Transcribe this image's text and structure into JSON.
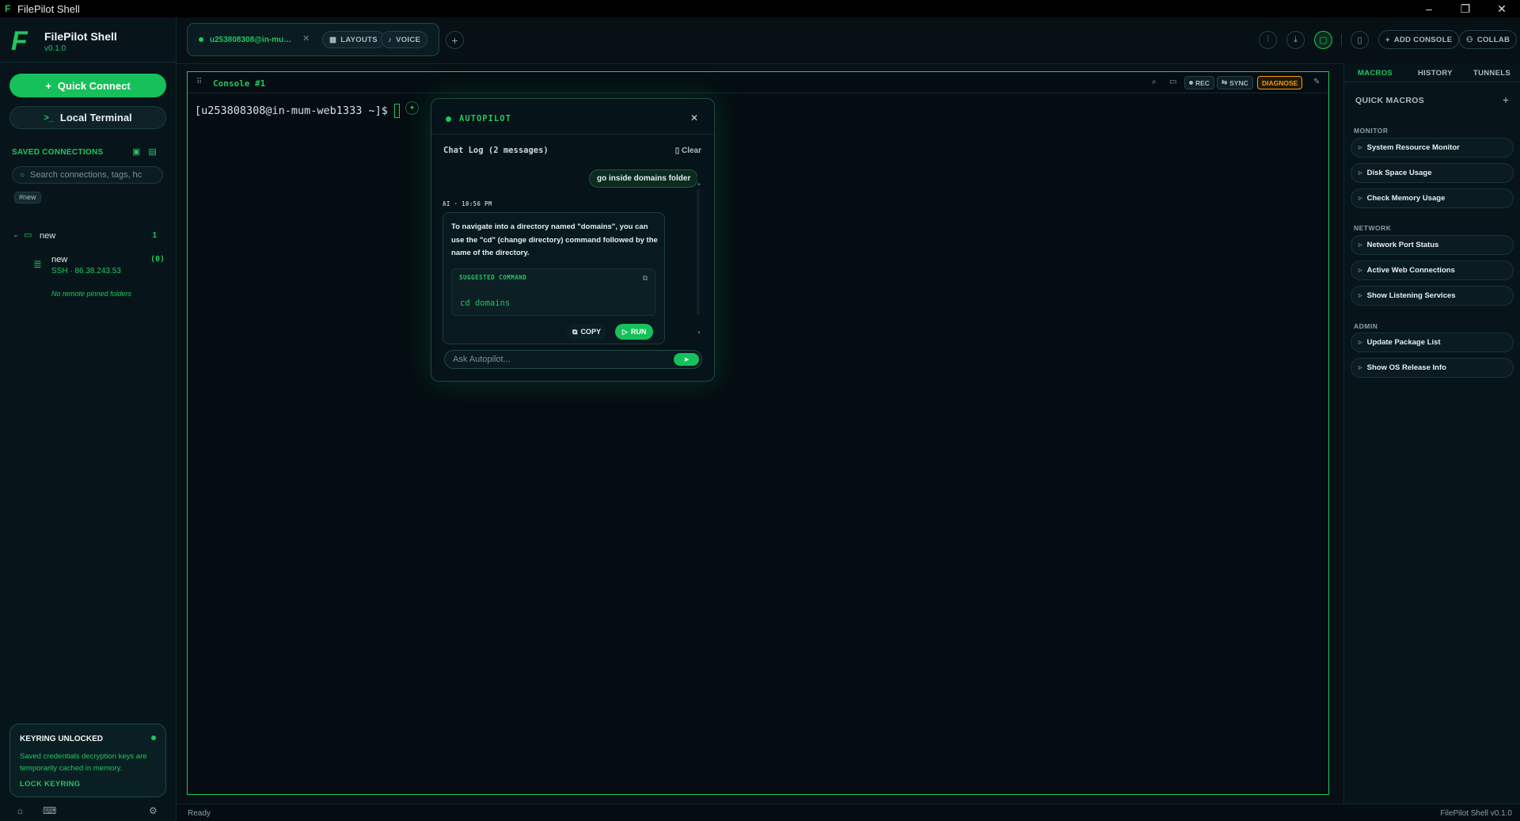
{
  "window": {
    "title": "FilePilot Shell",
    "controls": [
      "–",
      "❐",
      "✕"
    ]
  },
  "brand": {
    "name": "FilePilot Shell",
    "version": "v0.1.0"
  },
  "sidebar": {
    "quick_connect": "Quick Connect",
    "local_terminal": "Local Terminal",
    "saved_header": "SAVED CONNECTIONS",
    "search_placeholder": "Search connections, tags, hc",
    "tag": "#new",
    "folder": {
      "label": "new",
      "count": "1"
    },
    "connection": {
      "name": "new",
      "host": "SSH · 86.38.243.53",
      "status": "(0)"
    },
    "no_pinned": "No remote pinned folders",
    "keyring": {
      "title": "KEYRING UNLOCKED",
      "desc": "Saved credentials decryption keys are temporarily cached in memory.",
      "action": "LOCK KEYRING"
    }
  },
  "toolbar": {
    "tab_label": "u253808308@in-mum...",
    "layouts": "LAYOUTS",
    "voice": "VOICE",
    "add_console": "ADD CONSOLE",
    "collab": "COLLAB"
  },
  "console": {
    "title": "Console #1",
    "rec": "REC",
    "sync": "SYNC",
    "diagnose": "DIAGNOSE",
    "prompt": "[u253808308@in-mum-web1333 ~]$"
  },
  "autopilot": {
    "title": "AUTOPILOT",
    "chat_log_title": "Chat Log (2 messages)",
    "clear": "Clear",
    "user_message": "go inside domains folder",
    "ai_meta": "AI · 10:56 PM",
    "ai_text": "To navigate into a directory named \"domains\", you can use the \"cd\" (change directory) command followed by the name of the directory.",
    "suggested_label": "SUGGESTED COMMAND",
    "suggested_command": "cd domains",
    "copy": "COPY",
    "run": "RUN",
    "input_placeholder": "Ask Autopilot..."
  },
  "right_panel": {
    "tabs": [
      "MACROS",
      "HISTORY",
      "TUNNELS"
    ],
    "title": "QUICK MACROS",
    "groups": [
      {
        "label": "MONITOR",
        "items": [
          "System Resource Monitor",
          "Disk Space Usage",
          "Check Memory Usage"
        ]
      },
      {
        "label": "NETWORK",
        "items": [
          "Network Port Status",
          "Active Web Connections",
          "Show Listening Services"
        ]
      },
      {
        "label": "ADMIN",
        "items": [
          "Update Package List",
          "Show OS Release Info"
        ]
      }
    ]
  },
  "status_bar": {
    "left": "Ready",
    "right": "FilePilot Shell v0.1.0"
  },
  "colors": {
    "accent": "#22c55e",
    "warning": "#f59e0b",
    "background": "#061015"
  }
}
